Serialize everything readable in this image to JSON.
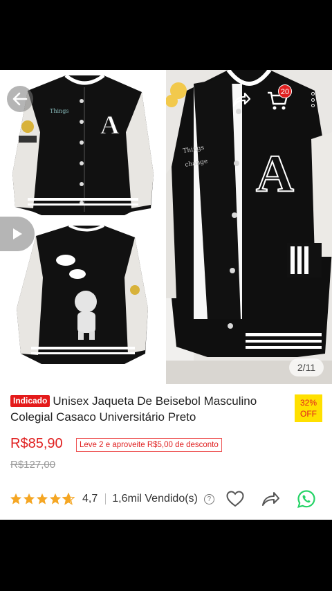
{
  "gallery": {
    "counter": "2/11",
    "cart_count": "20",
    "icons": [
      "back-arrow-icon",
      "play-icon",
      "share-icon",
      "cart-icon",
      "more-icon"
    ]
  },
  "product": {
    "tag": "Indicado",
    "title": "Unisex Jaqueta De Beisebol Masculino Colegial Casaco Universitário Preto",
    "discount_percent": "32%",
    "discount_label": "OFF",
    "price": "R$85,90",
    "promo": "Leve 2 e aproveite R$5,00 de desconto",
    "old_price": "R$127,00",
    "rating": "4,7",
    "rating_value": 4.7,
    "sold": "1,6mil Vendido(s)"
  },
  "colors": {
    "accent": "#e02020",
    "star": "#f5a623",
    "whatsapp": "#25d366",
    "discount_bg": "#ffe000"
  }
}
